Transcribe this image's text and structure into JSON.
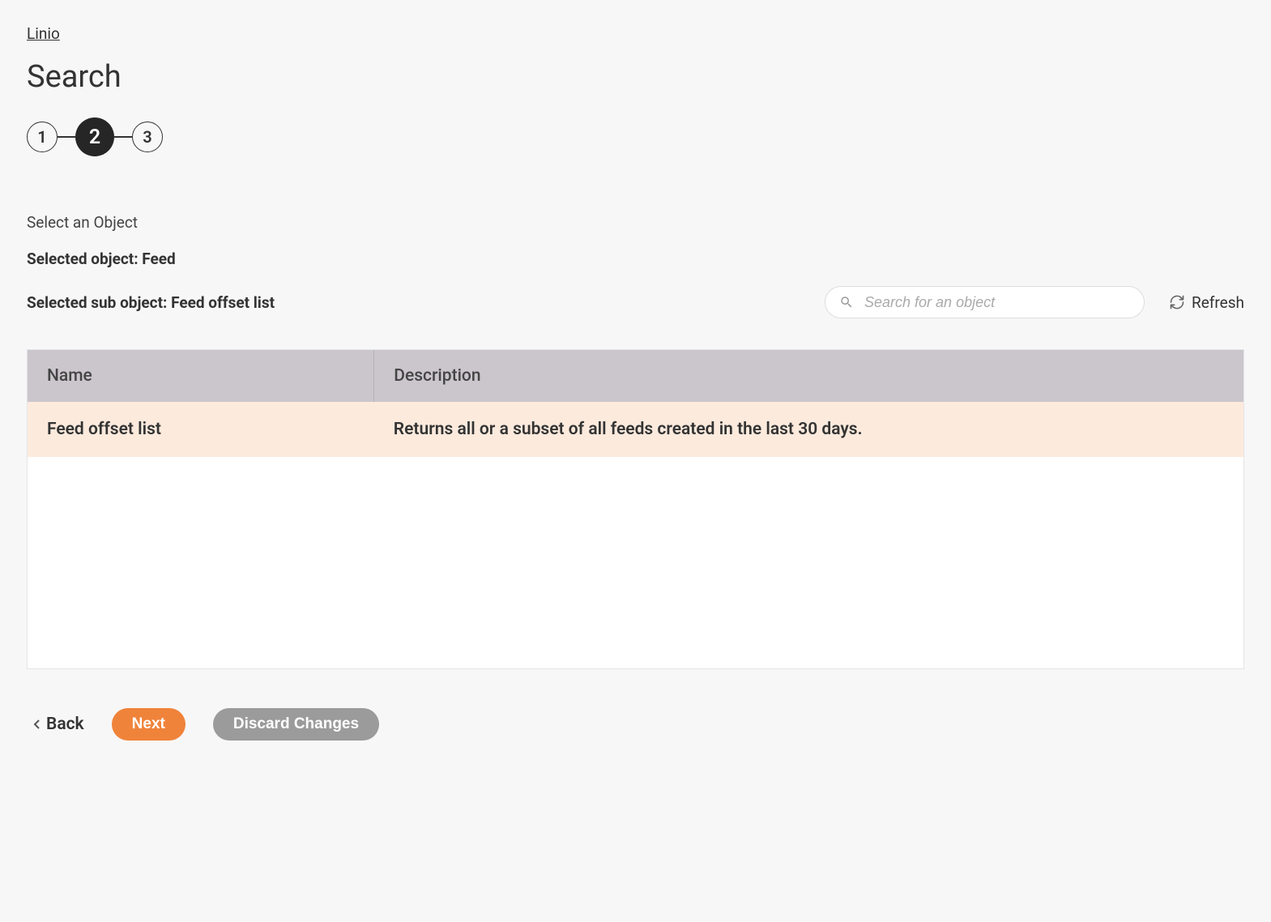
{
  "breadcrumb": {
    "label": "Linio"
  },
  "page": {
    "title": "Search"
  },
  "stepper": {
    "steps": [
      "1",
      "2",
      "3"
    ],
    "active_index": 1
  },
  "section": {
    "label": "Select an Object",
    "selected_object": "Selected object: Feed",
    "selected_sub_object": "Selected sub object: Feed offset list"
  },
  "search": {
    "placeholder": "Search for an object"
  },
  "refresh": {
    "label": "Refresh"
  },
  "table": {
    "columns": [
      "Name",
      "Description"
    ],
    "rows": [
      {
        "name": "Feed offset list",
        "description": "Returns all or a subset of all feeds created in the last 30 days."
      }
    ]
  },
  "footer": {
    "back": "Back",
    "next": "Next",
    "discard": "Discard Changes"
  }
}
